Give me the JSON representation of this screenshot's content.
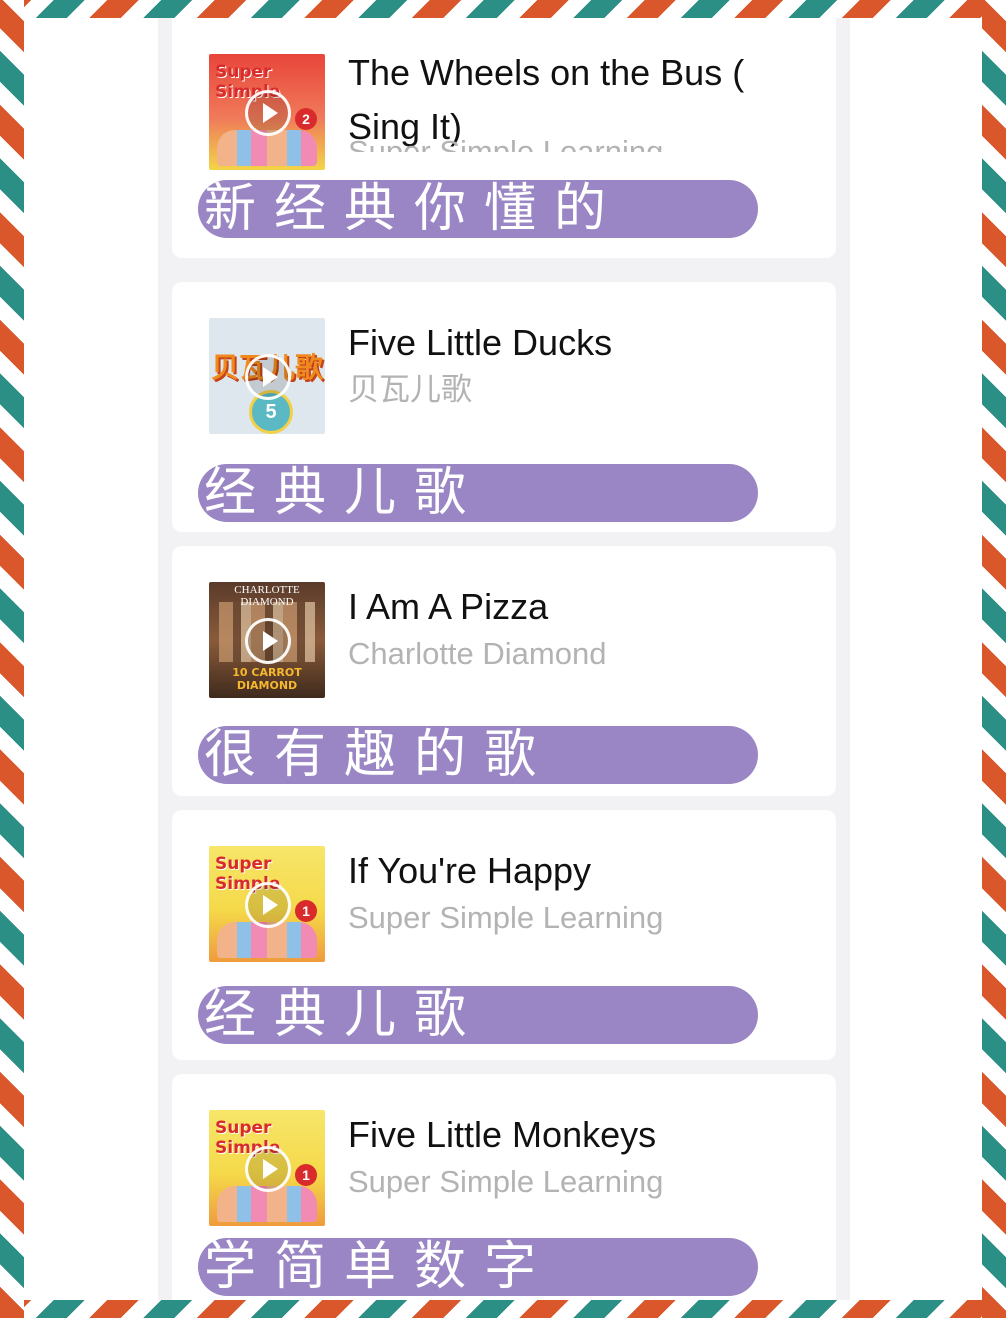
{
  "songs": [
    {
      "title": "The Wheels on the Bus ( Sing It)",
      "artist": "Super Simple Learning",
      "note": "新经典你懂的",
      "cover": {
        "brand": "Super Simple",
        "volume": "2",
        "style": "ss-red"
      }
    },
    {
      "title": "Five Little Ducks",
      "artist": "贝瓦儿歌",
      "note": "经典儿歌",
      "cover": {
        "brand": "贝瓦儿歌",
        "volume": "5",
        "style": "bw"
      }
    },
    {
      "title": "I Am A Pizza",
      "artist": "Charlotte Diamond",
      "note": "很有趣的歌",
      "cover": {
        "brand": "CHARLOTTE DIAMOND",
        "volume": "10 CARROT DIAMOND",
        "style": "cd"
      }
    },
    {
      "title": "If You're Happy",
      "artist": "Super Simple Learning",
      "note": "经典儿歌",
      "cover": {
        "brand": "Super Simple",
        "volume": "1",
        "style": "ss-yellow"
      }
    },
    {
      "title": "Five Little Monkeys",
      "artist": "Super Simple Learning",
      "note": "学简单数字",
      "cover": {
        "brand": "Super Simple",
        "volume": "1",
        "style": "ss-yellow"
      }
    }
  ],
  "colors": {
    "note_bg": "#9a86c4",
    "stripe_red": "#d9572b",
    "stripe_teal": "#2c8f86",
    "artist_gray": "#b3b3b3"
  }
}
